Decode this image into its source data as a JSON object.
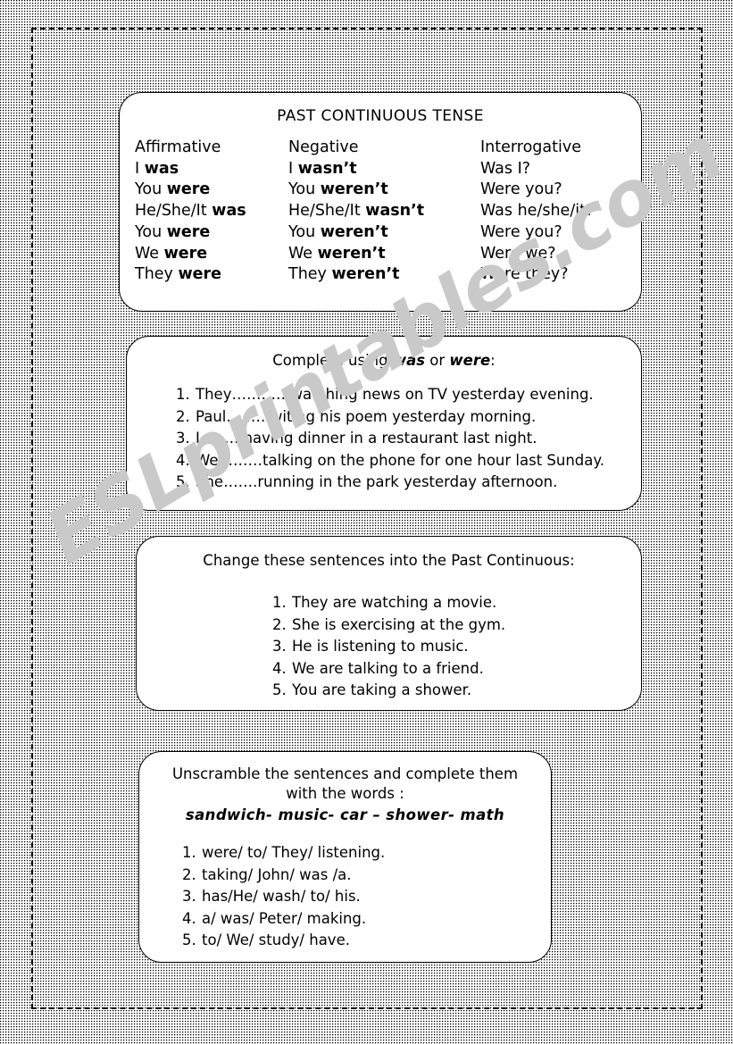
{
  "worksheet": {
    "title": "PAST CONTINUOUS TENSE",
    "watermark": "ESLprintables.com"
  },
  "conjugation": {
    "headers": {
      "affirmative": "Affirmative",
      "negative": "Negative",
      "interrogative": "Interrogative"
    },
    "rows": [
      {
        "aff_subject": "I ",
        "aff_verb": "was",
        "neg_subject": "I ",
        "neg_verb": "wasn’t",
        "int": "Was I?"
      },
      {
        "aff_subject": "You ",
        "aff_verb": "were",
        "neg_subject": "You ",
        "neg_verb": "weren’t",
        "int": "Were you?"
      },
      {
        "aff_subject": "He/She/It ",
        "aff_verb": "was",
        "neg_subject": "He/She/It ",
        "neg_verb": "wasn’t",
        "int": "Was he/she/it?"
      },
      {
        "aff_subject": "You ",
        "aff_verb": "were",
        "neg_subject": "You ",
        "neg_verb": "weren’t",
        "int": "Were you?"
      },
      {
        "aff_subject": "We ",
        "aff_verb": "were",
        "neg_subject": "We ",
        "neg_verb": "weren’t",
        "int": "Were we?"
      },
      {
        "aff_subject": "They ",
        "aff_verb": "were",
        "neg_subject": "They ",
        "neg_verb": "weren’t",
        "int": "Were they?"
      }
    ]
  },
  "exercise_complete": {
    "title_prefix": "Complete using ",
    "title_word1": "was",
    "title_mid": " or ",
    "title_word2": "were",
    "title_suffix": ":",
    "items": [
      {
        "num": "1.",
        "text": "They…………watching news on TV yesterday evening."
      },
      {
        "num": "2.",
        "text": "Paul………witing his poem yesterday morning."
      },
      {
        "num": "3.",
        "text": "I ……..having dinner in a restaurant last night."
      },
      {
        "num": "4.",
        "text": "We………talking on the phone for one hour last Sunday."
      },
      {
        "num": "5.",
        "text": "She…….running in the park yesterday afternoon."
      }
    ]
  },
  "exercise_change": {
    "title": "Change these sentences into the Past Continuous:",
    "items": [
      {
        "num": "1.",
        "text": "They are watching a movie."
      },
      {
        "num": "2.",
        "text": "She is exercising at the gym."
      },
      {
        "num": "3.",
        "text": "He is listening to music."
      },
      {
        "num": "4.",
        "text": "We are talking to a friend."
      },
      {
        "num": "5.",
        "text": "You are taking a shower."
      }
    ]
  },
  "exercise_unscramble": {
    "title_line1": "Unscramble the sentences and complete them",
    "title_line2": "with the words :",
    "wordbank": "sandwich- music- car – shower- math",
    "items": [
      {
        "num": "1.",
        "text": "were/ to/ They/ listening."
      },
      {
        "num": "2.",
        "text": "taking/ John/ was /a."
      },
      {
        "num": "3.",
        "text": "has/He/ wash/ to/ his."
      },
      {
        "num": "4.",
        "text": "a/ was/ Peter/ making."
      },
      {
        "num": "5.",
        "text": "to/ We/ study/ have."
      }
    ]
  }
}
